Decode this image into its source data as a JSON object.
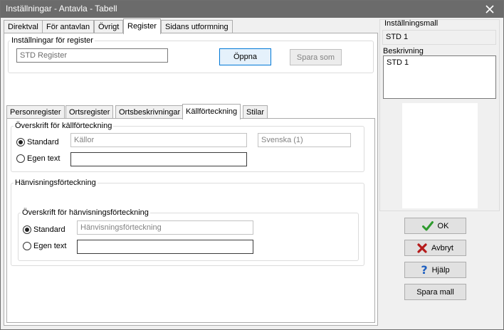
{
  "window": {
    "title": "Inställningar - Antavla - Tabell"
  },
  "tabs": [
    "Direktval",
    "För antavlan",
    "Övrigt",
    "Register",
    "Sidans utformning"
  ],
  "register_group": {
    "legend": "Inställningar för register",
    "name_value": "STD Register",
    "open_label": "Öppna",
    "save_as_label": "Spara som"
  },
  "subtabs": [
    "Personregister",
    "Ortsregister",
    "Ortsbeskrivningar",
    "Källförteckning",
    "Stilar"
  ],
  "kallforteckning": {
    "legend": "Överskrift för källförteckning",
    "standard_label": "Standard",
    "standard_value": "Källor",
    "language_value": "Svenska (1)",
    "own_label": "Egen text",
    "own_value": ""
  },
  "hanvisning": {
    "legend": "Hänvisningsförteckning",
    "inner_legend": "Överskrift för hänvisningsförteckning",
    "standard_label": "Standard",
    "standard_value": "Hänvisningsförteckning",
    "own_label": "Egen text",
    "own_value": ""
  },
  "sidebar": {
    "template_label": "Inställningsmall",
    "template_value": "STD 1",
    "description_label": "Beskrivning",
    "description_value": "STD 1"
  },
  "buttons": {
    "ok": "OK",
    "cancel": "Avbryt",
    "help": "Hjälp",
    "save_template": "Spara mall"
  },
  "colors": {
    "titlebar": "#6b6b6b",
    "ok_check": "#2e9a2e",
    "cancel_x": "#b51b1b",
    "help_q": "#1e5fc0"
  }
}
